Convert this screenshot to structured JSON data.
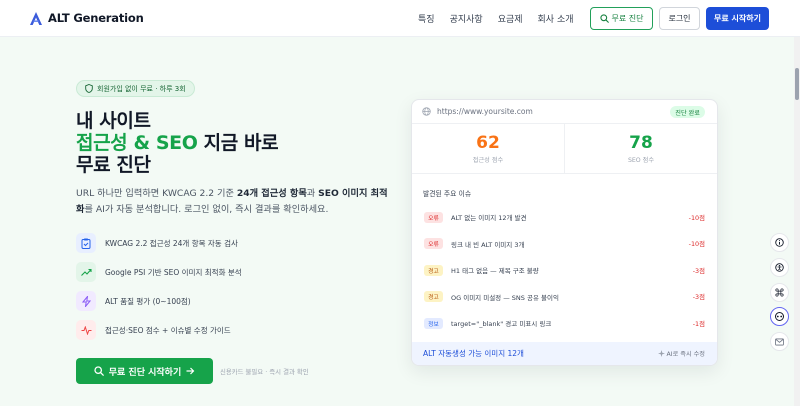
{
  "header": {
    "brand": "ALT Generation",
    "nav": [
      "특징",
      "공지사항",
      "요금제",
      "회사 소개"
    ],
    "diag_button": "무료 진단",
    "login_button": "로그인",
    "start_button": "무료 시작하기"
  },
  "hero": {
    "badge": "회원가입 없이 무료 · 하루 3회",
    "title_line1": "내 사이트",
    "title_line2_hl": "접근성 & SEO",
    "title_line2_rest": " 지금 바로",
    "title_line3": "무료 진단",
    "desc_1": "URL 하나만 입력하면 KWCAG 2.2 기준 ",
    "desc_b1": "24개 접근성 항목",
    "desc_2": "과 ",
    "desc_b2": "SEO 이미지 최적화",
    "desc_3": "를 AI가 자동 분석합니다. 로그인 없이, 즉시 결과를 확인하세요.",
    "features": [
      {
        "text": "KWCAG 2.2 접근성 24개 항목 자동 검사",
        "icon": "clipboard-check-icon",
        "bg": "#e8efff",
        "color": "#2563eb"
      },
      {
        "text": "Google PSI 기반 SEO 이미지 최적화 분석",
        "icon": "trend-up-icon",
        "bg": "#e3f5e9",
        "color": "#16a34a"
      },
      {
        "text": "ALT 품질 평가 (0~100점)",
        "icon": "lightning-icon",
        "bg": "#f1eaff",
        "color": "#8b5cf6"
      },
      {
        "text": "접근성·SEO 점수 + 이슈별 수정 가이드",
        "icon": "pulse-icon",
        "bg": "#ffecec",
        "color": "#ef4444"
      }
    ],
    "cta": "무료 진단 시작하기",
    "cta_note": "신용카드 불필요 · 즉시 결과 확인"
  },
  "card": {
    "url": "https://www.yoursite.com",
    "url_badge": "진단 완료",
    "scores": [
      {
        "value": "62",
        "label": "접근성 점수",
        "color": "#f97316"
      },
      {
        "value": "78",
        "label": "SEO 점수",
        "color": "#16a34a"
      }
    ],
    "issues_title": "발견된 주요 이슈",
    "issues": [
      {
        "tag": "오류",
        "text": "ALT 없는 이미지 12개 발견",
        "points": "-10점",
        "tag_bg": "#fde2e2",
        "tag_color": "#dc2626"
      },
      {
        "tag": "오류",
        "text": "링크 내 빈 ALT 이미지 3개",
        "points": "-10점",
        "tag_bg": "#fde2e2",
        "tag_color": "#dc2626"
      },
      {
        "tag": "경고",
        "text": "H1 태그 없음 — 제목 구조 불량",
        "points": "-3점",
        "tag_bg": "#fdf3c4",
        "tag_color": "#b45309"
      },
      {
        "tag": "경고",
        "text": "OG 이미지 미설정 — SNS 공유 불이익",
        "points": "-3점",
        "tag_bg": "#fdf3c4",
        "tag_color": "#b45309"
      },
      {
        "tag": "정보",
        "text": "target=\"_blank\" 경고 미표시 링크",
        "points": "-1점",
        "tag_bg": "#e3eaff",
        "tag_color": "#2563eb"
      }
    ],
    "footer_left": "ALT 자동생성 가능 이미지 12개",
    "footer_right": "AI로 즉시 수정"
  },
  "colors": {
    "accent_green": "#16a34a",
    "accent_blue": "#1d4ed8",
    "orange": "#f97316"
  },
  "floating_icons": [
    "info-icon",
    "accessibility-icon",
    "command-icon",
    "chat-bot-icon",
    "mail-icon"
  ]
}
